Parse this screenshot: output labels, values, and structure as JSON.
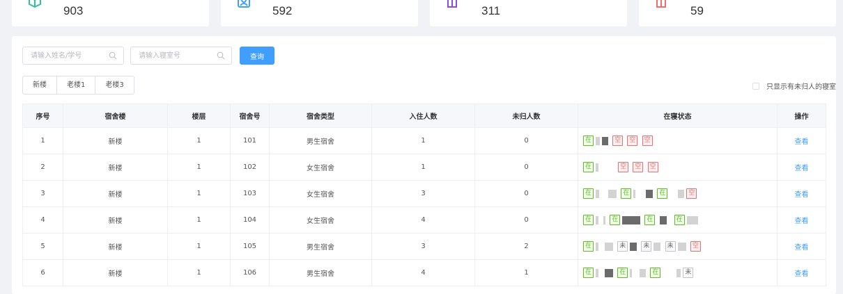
{
  "stats": [
    {
      "value": "903",
      "icon": "box-icon",
      "color": "#2fc39b"
    },
    {
      "value": "592",
      "icon": "user-card-icon",
      "color": "#409eff"
    },
    {
      "value": "311",
      "icon": "door-icon",
      "color": "#8a4be8"
    },
    {
      "value": "59",
      "icon": "door-icon",
      "color": "#f56c6c"
    }
  ],
  "search": {
    "name_placeholder": "请输入姓名/学号",
    "room_placeholder": "请输入寝室号",
    "query_label": "查询"
  },
  "tabs": [
    "新楼",
    "老楼1",
    "老楼3"
  ],
  "filter_label": "只显示有未归人的寝室",
  "table": {
    "headers": [
      "序号",
      "宿舍楼",
      "楼层",
      "宿舍号",
      "宿舍类型",
      "入住人数",
      "未归人数",
      "在寝状态",
      "操作"
    ],
    "rows": [
      {
        "idx": "1",
        "building": "新楼",
        "floor": "1",
        "room": "101",
        "type": "男生宿舍",
        "occupants": "1",
        "absent": "0",
        "op": "查看"
      },
      {
        "idx": "2",
        "building": "新楼",
        "floor": "1",
        "room": "102",
        "type": "女生宿舍",
        "occupants": "1",
        "absent": "0",
        "op": "查看"
      },
      {
        "idx": "3",
        "building": "新楼",
        "floor": "1",
        "room": "103",
        "type": "女生宿舍",
        "occupants": "3",
        "absent": "0",
        "op": "查看"
      },
      {
        "idx": "4",
        "building": "新楼",
        "floor": "1",
        "room": "104",
        "type": "女生宿舍",
        "occupants": "4",
        "absent": "0",
        "op": "查看"
      },
      {
        "idx": "5",
        "building": "新楼",
        "floor": "1",
        "room": "105",
        "type": "男生宿舍",
        "occupants": "3",
        "absent": "2",
        "op": "查看"
      },
      {
        "idx": "6",
        "building": "新楼",
        "floor": "1",
        "room": "106",
        "type": "男生宿舍",
        "occupants": "4",
        "absent": "1",
        "op": "查看"
      }
    ]
  },
  "status_labels": {
    "in": "在",
    "out": "未",
    "empty": "空"
  },
  "colors": {
    "accent": "#409eff",
    "in": "#52c41a",
    "empty": "#f56c6c"
  }
}
